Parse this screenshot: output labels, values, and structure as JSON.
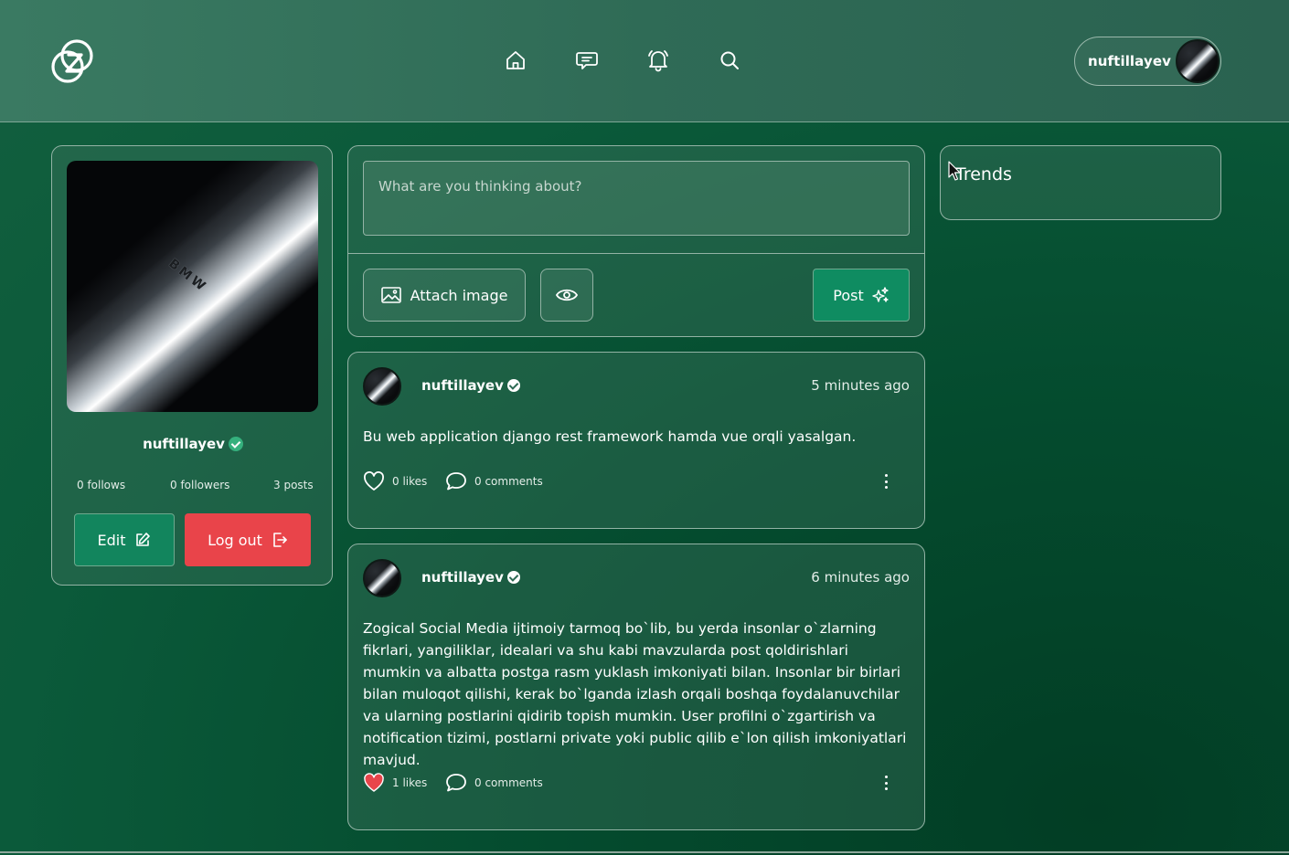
{
  "header": {
    "logo_icon": "zogical-logo-icon",
    "nav": [
      {
        "icon": "home-icon"
      },
      {
        "icon": "chat-icon"
      },
      {
        "icon": "bell-icon"
      },
      {
        "icon": "search-icon"
      }
    ],
    "user": {
      "username": "nuftillayev"
    }
  },
  "profile": {
    "cover_text": "BMW",
    "name": "nuftillayev",
    "stats": {
      "follows": "0 follows",
      "followers": "0 followers",
      "posts": "3 posts"
    },
    "edit_label": "Edit",
    "logout_label": "Log out"
  },
  "compose": {
    "placeholder": "What are you thinking about?",
    "attach_label": "Attach image",
    "post_label": "Post"
  },
  "posts": [
    {
      "author": "nuftillayev",
      "time": "5 minutes ago",
      "body": "Bu web application django rest framework hamda vue orqli yasalgan.",
      "likes": "0 likes",
      "comments": "0 comments",
      "liked": false
    },
    {
      "author": "nuftillayev",
      "time": "6 minutes ago",
      "body": "Zogical Social Media ijtimoiy tarmoq bo`lib, bu yerda insonlar o`zlarning fikrlari, yangiliklar, idealari va shu kabi mavzularda post qoldirishlari mumkin va albatta postga rasm yuklash imkoniyati bilan. Insonlar bir birlari bilan muloqot qilishi, kerak bo`lganda izlash orqali boshqa foydalanuvchilar va ularning postlarini qidirib topish mumkin. User profilni o`zgartirish va notification tizimi, postlarni private yoki public qilib e`lon qilish imkoniyatlari mavjud.",
      "likes": "1 likes",
      "comments": "0 comments",
      "liked": true
    }
  ],
  "trends": {
    "title": "Trends"
  },
  "colors": {
    "accent_green": "#12855d",
    "danger_red": "#e9444a",
    "verified_green": "#35b07d",
    "like_red": "#e8454b"
  }
}
